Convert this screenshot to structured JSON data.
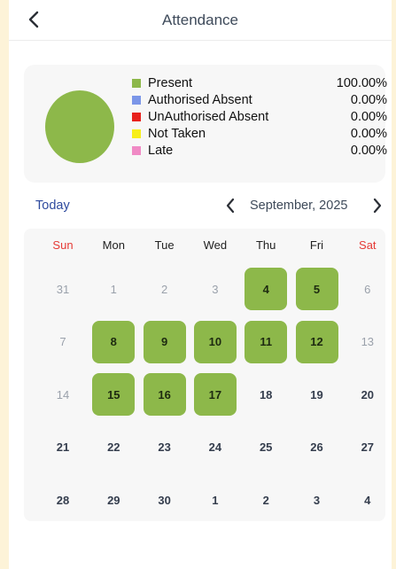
{
  "header": {
    "title": "Attendance"
  },
  "summary": {
    "pie_color": "#8db84a",
    "items": [
      {
        "label": "Present",
        "value": "100.00%",
        "color": "#8db84a"
      },
      {
        "label": "Authorised Absent",
        "value": "0.00%",
        "color": "#7b96e8"
      },
      {
        "label": "UnAuthorised Absent",
        "value": "0.00%",
        "color": "#e8211d"
      },
      {
        "label": "Not Taken",
        "value": "0.00%",
        "color": "#f7ef1a"
      },
      {
        "label": "Late",
        "value": "0.00%",
        "color": "#f08ac5"
      }
    ]
  },
  "calendar": {
    "today_label": "Today",
    "month_label": "September, 2025",
    "weekdays": [
      "Sun",
      "Mon",
      "Tue",
      "Wed",
      "Thu",
      "Fri",
      "Sat"
    ],
    "weeks": [
      [
        {
          "d": "31",
          "muted": true
        },
        {
          "d": "1",
          "muted": true
        },
        {
          "d": "2",
          "muted": true
        },
        {
          "d": "3",
          "muted": true
        },
        {
          "d": "4",
          "present": true
        },
        {
          "d": "5",
          "present": true
        },
        {
          "d": "6",
          "muted": true
        }
      ],
      [
        {
          "d": "7",
          "muted": true
        },
        {
          "d": "8",
          "present": true
        },
        {
          "d": "9",
          "present": true
        },
        {
          "d": "10",
          "present": true
        },
        {
          "d": "11",
          "present": true
        },
        {
          "d": "12",
          "present": true
        },
        {
          "d": "13",
          "muted": true
        }
      ],
      [
        {
          "d": "14",
          "muted": true
        },
        {
          "d": "15",
          "present": true
        },
        {
          "d": "16",
          "present": true
        },
        {
          "d": "17",
          "present": true
        },
        {
          "d": "18"
        },
        {
          "d": "19"
        },
        {
          "d": "20"
        }
      ],
      [
        {
          "d": "21"
        },
        {
          "d": "22"
        },
        {
          "d": "23"
        },
        {
          "d": "24"
        },
        {
          "d": "25"
        },
        {
          "d": "26"
        },
        {
          "d": "27"
        }
      ],
      [
        {
          "d": "28"
        },
        {
          "d": "29"
        },
        {
          "d": "30"
        },
        {
          "d": "1"
        },
        {
          "d": "2"
        },
        {
          "d": "3"
        },
        {
          "d": "4"
        }
      ]
    ]
  }
}
